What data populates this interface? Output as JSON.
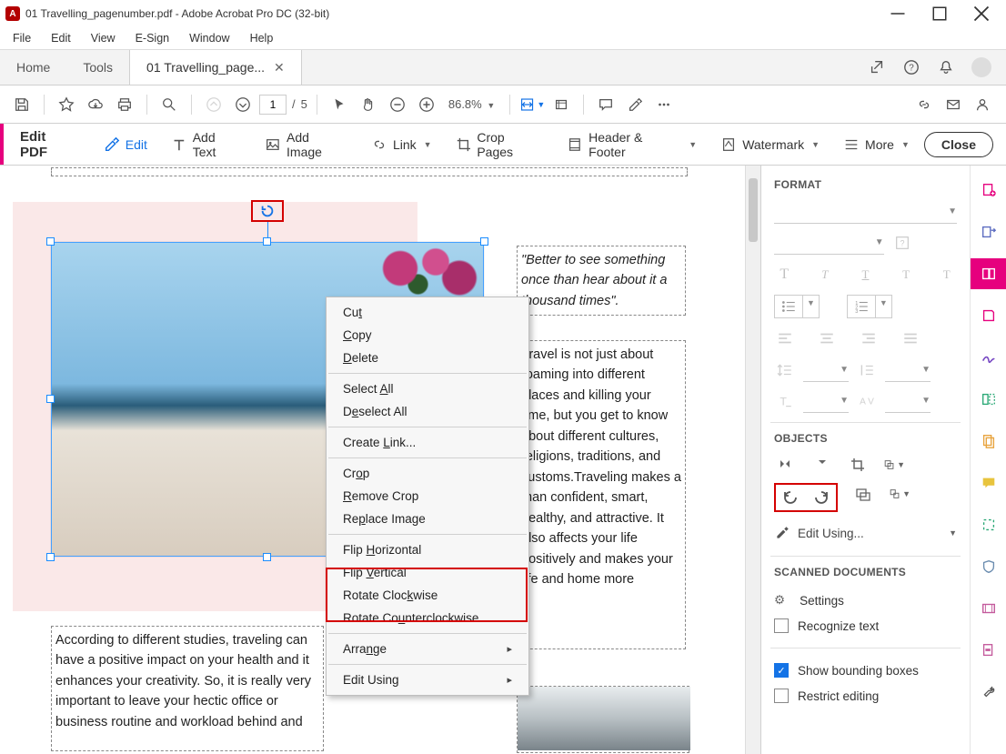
{
  "window": {
    "title": "01 Travelling_pagenumber.pdf - Adobe Acrobat Pro DC (32-bit)"
  },
  "menubar": {
    "items": [
      "File",
      "Edit",
      "View",
      "E-Sign",
      "Window",
      "Help"
    ]
  },
  "tabs": {
    "home": "Home",
    "tools": "Tools",
    "doc": "01 Travelling_page..."
  },
  "toolbar": {
    "page_current": "1",
    "page_sep": "/",
    "page_total": "5",
    "zoom": "86.8%"
  },
  "edit_toolbar": {
    "title": "Edit PDF",
    "edit": "Edit",
    "add_text": "Add Text",
    "add_image": "Add Image",
    "link": "Link",
    "crop_pages": "Crop Pages",
    "header_footer": "Header & Footer",
    "watermark": "Watermark",
    "more": "More",
    "close": "Close"
  },
  "document": {
    "quote": "\"Better to see something once than hear about it a thousand times\".",
    "para_right": "Travel is not just about roaming into different places and killing your time, but you get to know about different cultures, religions, traditions, and customs.Traveling makes a man confident, smart, healthy, and attractive. It also affects your life positively and makes your life and home more",
    "para_bottom": "According to different studies, traveling can have a positive impact on your health and it enhances your creativity. So, it is really very important to leave your hectic office or business routine and workload behind and"
  },
  "context_menu": {
    "cut": "Cut",
    "copy": "Copy",
    "delete": "Delete",
    "select_all": "Select All",
    "deselect_all": "Deselect All",
    "create_link": "Create Link...",
    "crop": "Crop",
    "remove_crop": "Remove Crop",
    "replace_image": "Replace Image",
    "flip_horizontal": "Flip Horizontal",
    "flip_vertical": "Flip Vertical",
    "rotate_clockwise": "Rotate Clockwise",
    "rotate_counterclockwise": "Rotate Counterclockwise",
    "arrange": "Arrange",
    "edit_using": "Edit Using"
  },
  "right_panel": {
    "format_title": "FORMAT",
    "objects_title": "OBJECTS",
    "edit_using": "Edit Using...",
    "scanned_title": "SCANNED DOCUMENTS",
    "settings": "Settings",
    "recognize_text": "Recognize text",
    "show_bounding": "Show bounding boxes",
    "restrict_editing": "Restrict editing"
  }
}
